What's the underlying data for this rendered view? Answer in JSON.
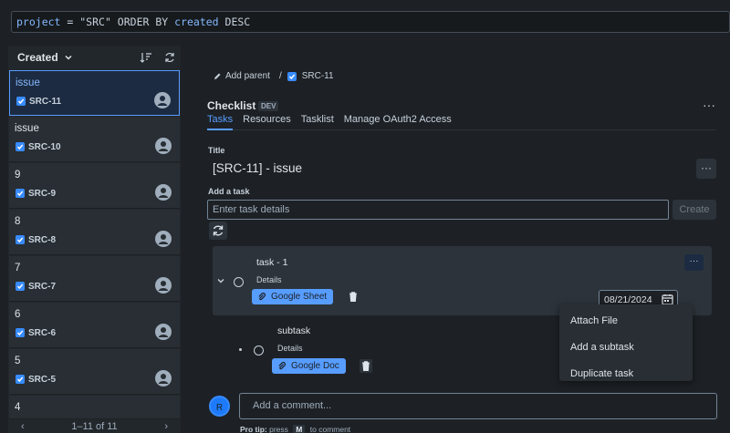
{
  "jql": {
    "kw1": "project",
    "op": " = ",
    "val": "\"SRC\"",
    "rest_kw": " ORDER BY ",
    "field": "created",
    "dir": " DESC"
  },
  "sidebar": {
    "sort_label": "Created",
    "items": [
      {
        "summary": "issue",
        "key": "SRC-11"
      },
      {
        "summary": "issue",
        "key": "SRC-10"
      },
      {
        "summary": "9",
        "key": "SRC-9"
      },
      {
        "summary": "8",
        "key": "SRC-8"
      },
      {
        "summary": "7",
        "key": "SRC-7"
      },
      {
        "summary": "6",
        "key": "SRC-6"
      },
      {
        "summary": "5",
        "key": "SRC-5"
      },
      {
        "summary": "4",
        "key": ""
      }
    ],
    "pager": {
      "prev": "‹",
      "text": "1–11 of 11",
      "next": "›"
    }
  },
  "breadcrumb": {
    "add_parent": "Add parent",
    "sep": "/",
    "issue_key": "SRC-11"
  },
  "panel": {
    "title": "Checklist",
    "badge": "DEV",
    "more": "···",
    "tabs": [
      "Tasks",
      "Resources",
      "Tasklist",
      "Manage OAuth2 Access"
    ]
  },
  "form": {
    "title_label": "Title",
    "title_value": "[SRC-11] - issue",
    "title_more": "···",
    "add_task_label": "Add a task",
    "add_task_placeholder": "Enter task details",
    "create_label": "Create"
  },
  "tasks": [
    {
      "name": "task - 1",
      "details_label": "Details",
      "attachment": "Google Sheet",
      "date": "08/21/2024",
      "more": "···"
    },
    {
      "name": "subtask",
      "details_label": "Details",
      "attachment": "Google Doc"
    }
  ],
  "menu": {
    "items": [
      "Attach File",
      "Add a subtask",
      "Duplicate task"
    ]
  },
  "comment": {
    "avatar_initial": "R",
    "placeholder": "Add a comment...",
    "protip_prefix": "Pro tip:",
    "protip_press": "press",
    "protip_key": "M",
    "protip_suffix": "to comment"
  },
  "colors": {
    "accent": "#579dff",
    "background": "#1d2125",
    "card": "#282e33",
    "selected_card": "#1c2b41"
  }
}
